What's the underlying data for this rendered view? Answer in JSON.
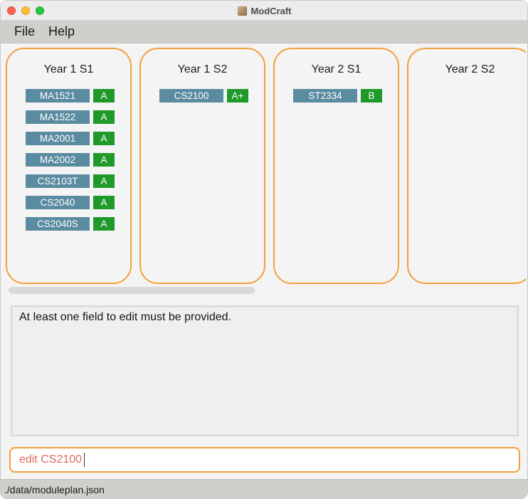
{
  "window": {
    "title": "ModCraft",
    "app_icon": "modcraft-app-icon"
  },
  "menu": {
    "items": [
      "File",
      "Help"
    ]
  },
  "semesters": [
    {
      "name": "Year 1 S1",
      "modules": [
        {
          "code": "MA1521",
          "grade": "A"
        },
        {
          "code": "MA1522",
          "grade": "A"
        },
        {
          "code": "MA2001",
          "grade": "A"
        },
        {
          "code": "MA2002",
          "grade": "A"
        },
        {
          "code": "CS2103T",
          "grade": "A"
        },
        {
          "code": "CS2040",
          "grade": "A"
        },
        {
          "code": "CS2040S",
          "grade": "A"
        }
      ]
    },
    {
      "name": "Year 1 S2",
      "modules": [
        {
          "code": "CS2100",
          "grade": "A+"
        }
      ]
    },
    {
      "name": "Year 2 S1",
      "modules": [
        {
          "code": "ST2334",
          "grade": "B"
        }
      ]
    },
    {
      "name": "Year 2 S2",
      "modules": []
    }
  ],
  "result": {
    "message": "At least one field to edit must be provided."
  },
  "command": {
    "value": "edit CS2100"
  },
  "status": {
    "path": "./data/moduleplan.json"
  },
  "colors": {
    "accent_border": "#f2a03a",
    "module_code_bg": "#5a8ba0",
    "grade_bg": "#1f9a2a",
    "command_text": "#e0685a"
  }
}
